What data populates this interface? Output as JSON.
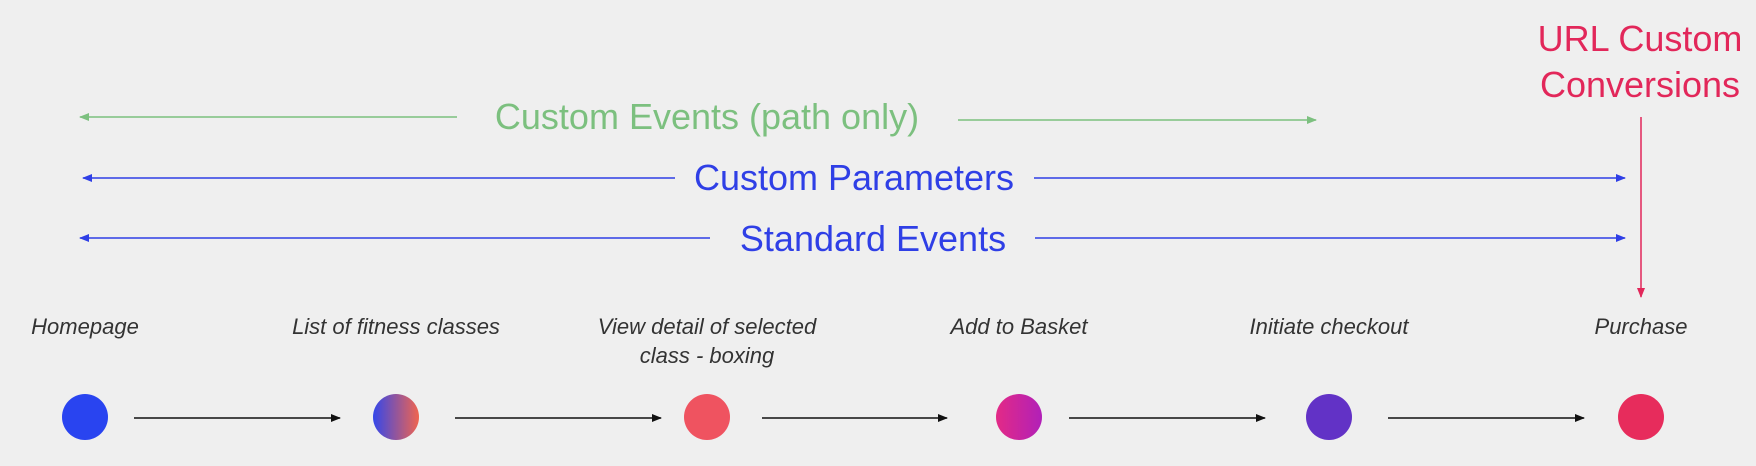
{
  "bands": {
    "custom_events": {
      "label": "Custom Events (path only)",
      "color": "#7cc07f"
    },
    "custom_parameters": {
      "label": "Custom Parameters",
      "color": "#2f3fe6"
    },
    "standard_events": {
      "label": "Standard Events",
      "color": "#2f3fe6"
    }
  },
  "url_conversions": {
    "line1": "URL Custom",
    "line2": "Conversions",
    "color": "#e2275a"
  },
  "steps": [
    {
      "label": "Homepage",
      "color": "#2944f0"
    },
    {
      "label": "List of fitness classes",
      "color": "linear-gradient(90deg, #3447ea, #f0644f)"
    },
    {
      "label": "View detail of selected class - boxing",
      "color": "#ef5360"
    },
    {
      "label": "Add to Basket",
      "color": "linear-gradient(90deg, #e32a86, #b120b8)"
    },
    {
      "label": "Initiate checkout",
      "color": "#6232c6"
    },
    {
      "label": "Purchase",
      "color": "#e72c5c"
    }
  ]
}
